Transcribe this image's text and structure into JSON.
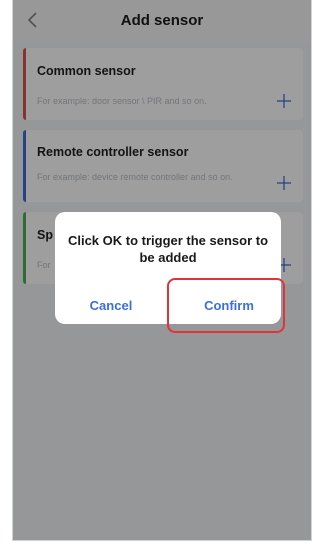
{
  "header": {
    "title": "Add sensor"
  },
  "sensors": [
    {
      "name": "Common sensor",
      "hint": "For example: door sensor \\ PIR and so on.",
      "color": "#d9534f"
    },
    {
      "name": "Remote controller sensor",
      "hint": "For example: device remote controller and so on.",
      "color": "#3d6fd8"
    },
    {
      "name": "Sp",
      "hint": "For",
      "color": "#4caf50"
    }
  ],
  "dialog": {
    "message": "Click OK to trigger the sensor to be added",
    "cancel_label": "Cancel",
    "confirm_label": "Confirm"
  },
  "colors": {
    "accent": "#3c6fd9",
    "highlight": "#e0343a"
  }
}
